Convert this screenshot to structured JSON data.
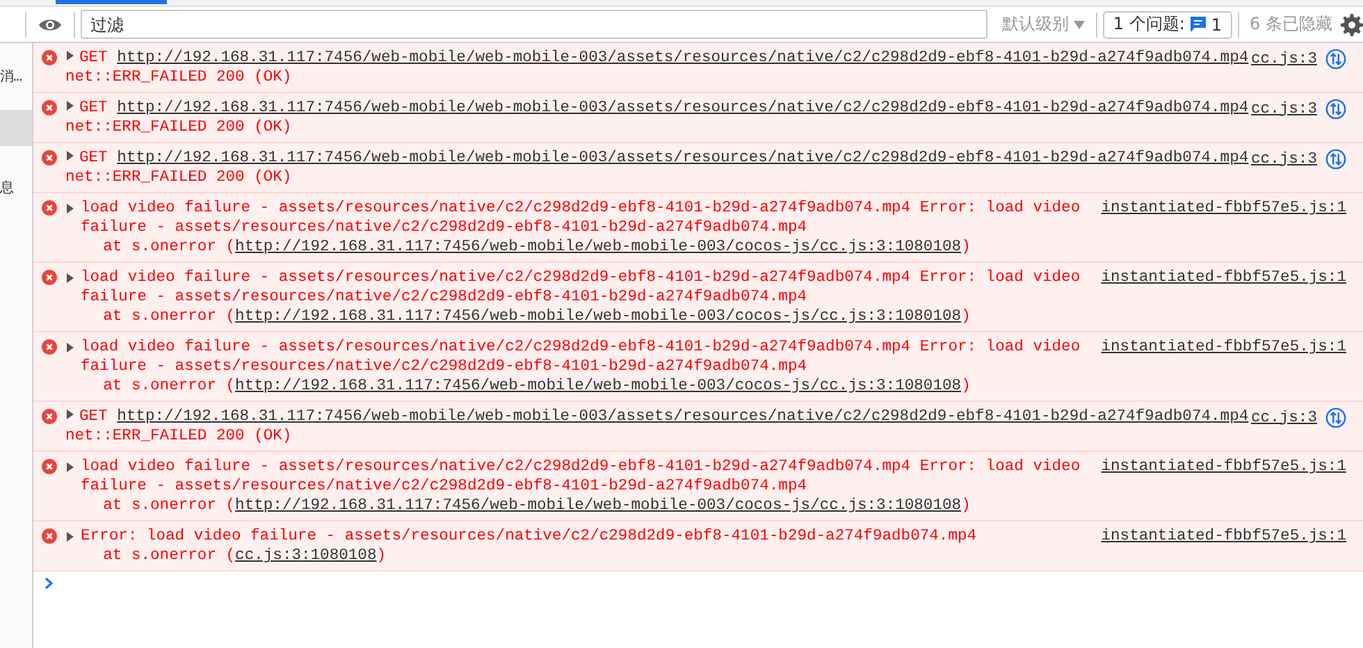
{
  "sidebar": {
    "items": [
      {
        "label": "消...",
        "selected": false
      },
      {
        "selected": true
      },
      {
        "label": "息",
        "selected": false
      }
    ]
  },
  "toolbar": {
    "filter": {
      "placeholder": "过滤"
    },
    "level_menu": "默认级别",
    "issues": {
      "label": "1 个问题:",
      "count": "1"
    },
    "hidden": "6 条已隐藏"
  },
  "messages": [
    {
      "kind": "network",
      "method": "GET",
      "url": "http://192.168.31.117:7456/web-mobile/web-mobile-003/assets/resources/native/c2/c298d2d9-ebf8-4101-b29d-a274f9adb074.mp4",
      "status": "net::ERR_FAILED 200 (OK)",
      "source": "cc.js:3"
    },
    {
      "kind": "network",
      "method": "GET",
      "url": "http://192.168.31.117:7456/web-mobile/web-mobile-003/assets/resources/native/c2/c298d2d9-ebf8-4101-b29d-a274f9adb074.mp4",
      "status": "net::ERR_FAILED 200 (OK)",
      "source": "cc.js:3"
    },
    {
      "kind": "network",
      "method": "GET",
      "url": "http://192.168.31.117:7456/web-mobile/web-mobile-003/assets/resources/native/c2/c298d2d9-ebf8-4101-b29d-a274f9adb074.mp4",
      "status": "net::ERR_FAILED 200 (OK)",
      "source": "cc.js:3"
    },
    {
      "kind": "error",
      "text": "load video failure - assets/resources/native/c2/c298d2d9-ebf8-4101-b29d-a274f9adb074.mp4 Error: load video failure - assets/resources/native/c2/c298d2d9-ebf8-4101-b29d-a274f9adb074.mp4",
      "stack": "at s.onerror (",
      "stack_link": "http://192.168.31.117:7456/web-mobile/web-mobile-003/cocos-js/cc.js:3:1080108",
      "stack_end": ")",
      "source": "instantiated-fbbf57e5.js:1"
    },
    {
      "kind": "error",
      "text": "load video failure - assets/resources/native/c2/c298d2d9-ebf8-4101-b29d-a274f9adb074.mp4 Error: load video failure - assets/resources/native/c2/c298d2d9-ebf8-4101-b29d-a274f9adb074.mp4",
      "stack": "at s.onerror (",
      "stack_link": "http://192.168.31.117:7456/web-mobile/web-mobile-003/cocos-js/cc.js:3:1080108",
      "stack_end": ")",
      "source": "instantiated-fbbf57e5.js:1"
    },
    {
      "kind": "error",
      "text": "load video failure - assets/resources/native/c2/c298d2d9-ebf8-4101-b29d-a274f9adb074.mp4 Error: load video failure - assets/resources/native/c2/c298d2d9-ebf8-4101-b29d-a274f9adb074.mp4",
      "stack": "at s.onerror (",
      "stack_link": "http://192.168.31.117:7456/web-mobile/web-mobile-003/cocos-js/cc.js:3:1080108",
      "stack_end": ")",
      "source": "instantiated-fbbf57e5.js:1"
    },
    {
      "kind": "network",
      "method": "GET",
      "url": "http://192.168.31.117:7456/web-mobile/web-mobile-003/assets/resources/native/c2/c298d2d9-ebf8-4101-b29d-a274f9adb074.mp4",
      "status": "net::ERR_FAILED 200 (OK)",
      "source": "cc.js:3"
    },
    {
      "kind": "error",
      "text": "load video failure - assets/resources/native/c2/c298d2d9-ebf8-4101-b29d-a274f9adb074.mp4 Error: load video failure - assets/resources/native/c2/c298d2d9-ebf8-4101-b29d-a274f9adb074.mp4",
      "stack": "at s.onerror (",
      "stack_link": "http://192.168.31.117:7456/web-mobile/web-mobile-003/cocos-js/cc.js:3:1080108",
      "stack_end": ")",
      "source": "instantiated-fbbf57e5.js:1"
    },
    {
      "kind": "error",
      "text": "Error: load video failure - assets/resources/native/c2/c298d2d9-ebf8-4101-b29d-a274f9adb074.mp4",
      "stack": "at s.onerror (",
      "stack_link": "cc.js:3:1080108",
      "stack_end": ")",
      "source": "instantiated-fbbf57e5.js:1"
    }
  ]
}
